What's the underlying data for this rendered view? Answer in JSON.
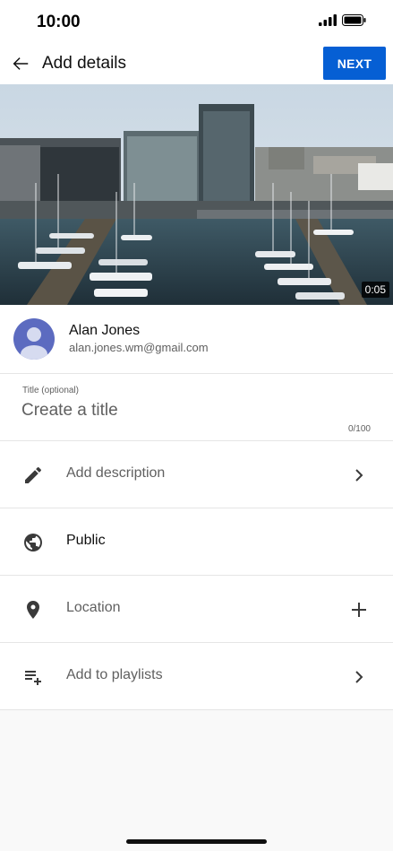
{
  "status_bar": {
    "time": "10:00"
  },
  "header": {
    "title": "Add details",
    "next_label": "NEXT"
  },
  "video": {
    "duration": "0:05"
  },
  "account": {
    "name": "Alan Jones",
    "email": "alan.jones.wm@gmail.com"
  },
  "title_field": {
    "label": "Title (optional)",
    "placeholder": "Create a title",
    "value": "",
    "counter": "0/100"
  },
  "rows": [
    {
      "label": "Add description",
      "icon": "pencil-icon",
      "action": "chevron-right-icon"
    },
    {
      "label": "Public",
      "icon": "globe-icon",
      "action": ""
    },
    {
      "label": "Location",
      "icon": "location-pin-icon",
      "action": "plus-icon"
    },
    {
      "label": "Add to playlists",
      "icon": "playlist-add-icon",
      "action": "chevron-right-icon"
    }
  ],
  "colors": {
    "accent": "#065fd4",
    "avatar": "#5c6bc0",
    "text_primary": "#0f0f0f",
    "text_secondary": "#606060"
  }
}
